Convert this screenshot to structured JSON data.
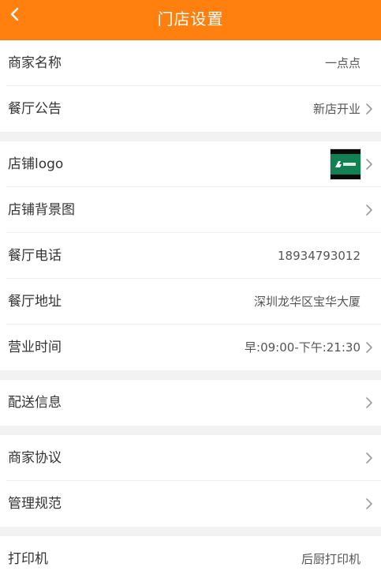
{
  "header": {
    "title": "门店设置"
  },
  "groups": [
    {
      "rows": [
        {
          "label": "商家名称",
          "value": "一点点"
        },
        {
          "label": "餐厅公告",
          "value": "新店开业"
        }
      ]
    },
    {
      "rows": [
        {
          "label": "店铺logo"
        },
        {
          "label": "店铺背景图"
        },
        {
          "label": "餐厅电话",
          "value": "18934793012"
        },
        {
          "label": "餐厅地址",
          "value": "深圳龙华区宝华大厦"
        },
        {
          "label": "营业时间",
          "value": "早:09:00-下午:21:30"
        }
      ]
    },
    {
      "rows": [
        {
          "label": "配送信息"
        }
      ]
    },
    {
      "rows": [
        {
          "label": "商家协议"
        },
        {
          "label": "管理规范"
        }
      ]
    },
    {
      "rows": [
        {
          "label": "打印机",
          "value": "后厨打印机"
        }
      ]
    }
  ],
  "colors": {
    "header_bg": "#ff7f0f",
    "logo_green": "#118055"
  }
}
